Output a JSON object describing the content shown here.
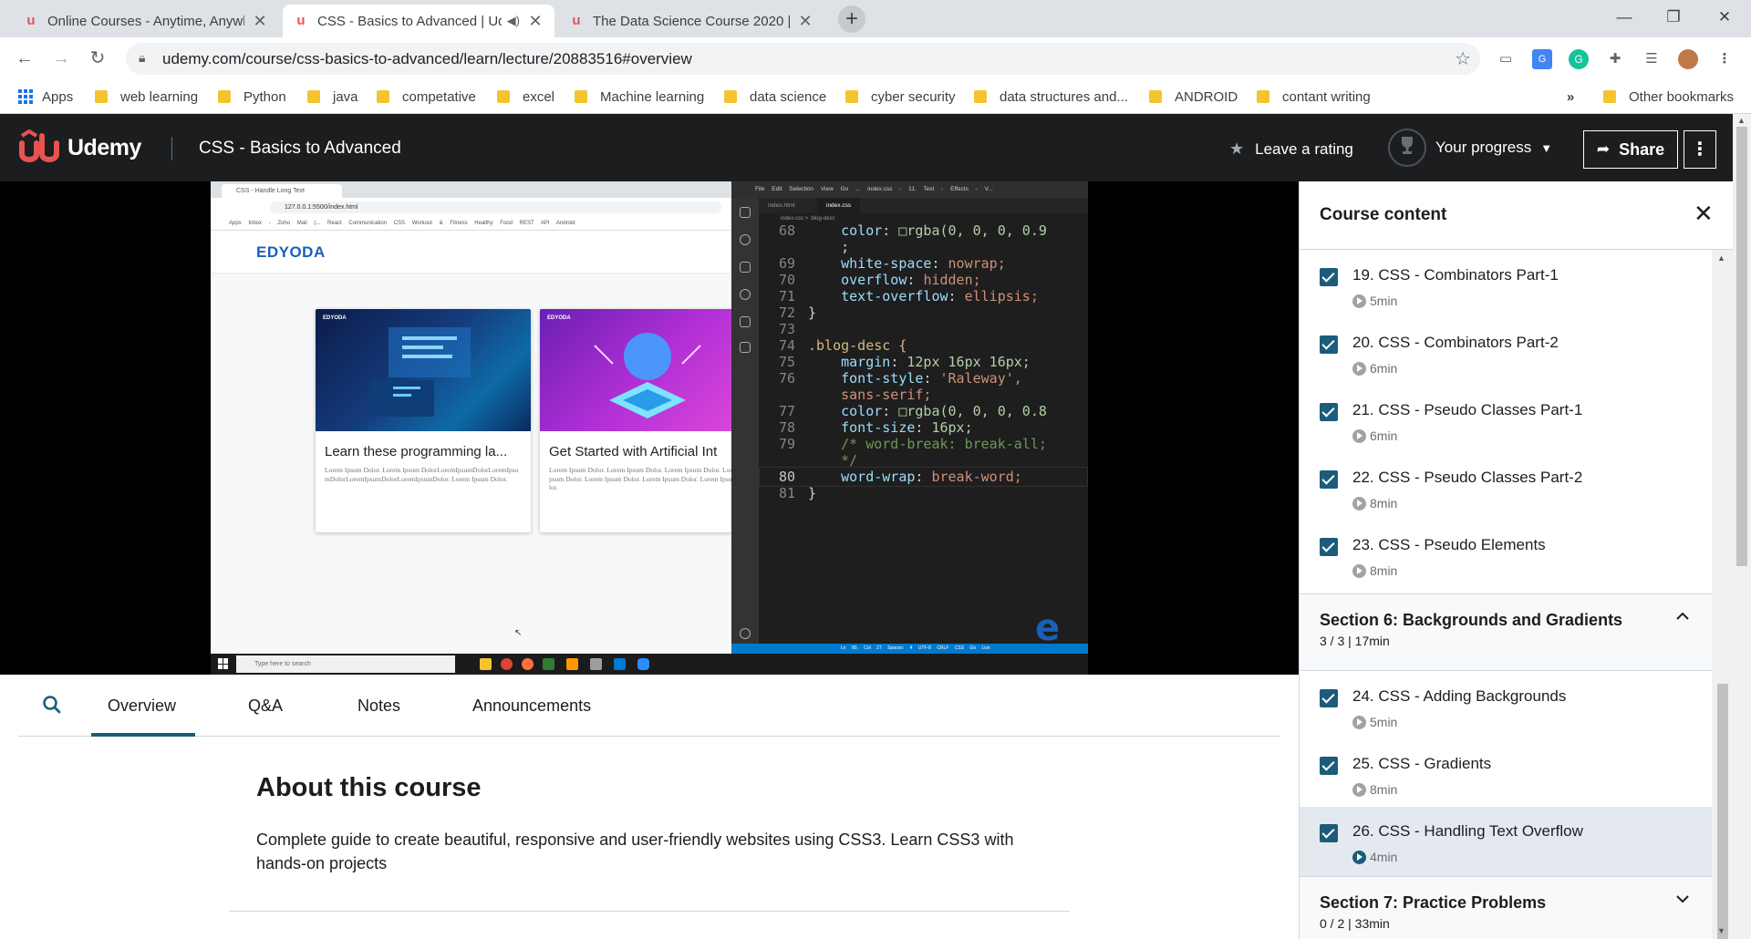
{
  "browser": {
    "tabs": [
      {
        "title": "Online Courses - Anytime, Anywh",
        "active": false
      },
      {
        "title": "CSS - Basics to Advanced | Ud",
        "active": true,
        "audio": true
      },
      {
        "title": "The Data Science Course 2020 | U",
        "active": false
      }
    ],
    "url": "udemy.com/course/css-basics-to-advanced/learn/lecture/20883516#overview",
    "bookmarks": [
      "Apps",
      "web learning",
      "Python",
      "java",
      "competative",
      "excel",
      "Machine learning",
      "data science",
      "cyber security",
      "data structures and...",
      "ANDROID",
      "contant writing"
    ],
    "bookmarks_more": "»",
    "other_bookmarks": "Other bookmarks"
  },
  "header": {
    "brand": "Udemy",
    "course_title": "CSS - Basics to Advanced",
    "leave_rating": "Leave a rating",
    "your_progress": "Your progress",
    "share": "Share"
  },
  "video": {
    "mini_browser": {
      "tab": "CSS - Handle Long Text",
      "url": "127.0.0.1:5500/index.html",
      "bookmarks": "Apps Inbox - Zoho Mail (... React Communication CSS Workout & Fitness Healthy Food REST API Android"
    },
    "site_brand": "EDYODA",
    "cards": [
      {
        "brand": "EDYODA",
        "title": "Learn these programming la...",
        "desc": "Lorem Ipsum Dolor. Lorem Ipsum DolorLoremIpsumDolorLoremIpsumDolorLoremIpsumDolorLoremIpsumDolor. Lorem Ipsum Dolor."
      },
      {
        "brand": "EDYODA",
        "title": "Get Started with Artificial Int",
        "desc": "Lorem Ipsum Dolor. Lorem Ipsum Dolor. Lorem Ipsum Dolor. Lorem Ipsum Dolor. Lorem Ipsum Dolor. Lorem Ipsum Dolor. Lorem Ipsum Dolor."
      }
    ],
    "taskbar_search": "Type here to search",
    "vscode": {
      "title": "File  Edit  Selection  View  Go  ...  index.css - 11. Text - Effects - V...",
      "tabs": [
        "index.html",
        "index.css"
      ],
      "breadcrumb": "index.css > .blog-desc",
      "status": "Ln 80, Col 27  Spaces: 4  UTF-8  CRLF  CSS  Go Live",
      "lines": [
        {
          "n": "68",
          "code": "    color: □rgba(0, 0, 0, 0.9"
        },
        {
          "n": "",
          "code": "    ;"
        },
        {
          "n": "69",
          "code": "    white-space: nowrap;"
        },
        {
          "n": "70",
          "code": "    overflow: hidden;"
        },
        {
          "n": "71",
          "code": "    text-overflow: ellipsis;"
        },
        {
          "n": "72",
          "code": "}"
        },
        {
          "n": "73",
          "code": ""
        },
        {
          "n": "74",
          "code": ".blog-desc {"
        },
        {
          "n": "75",
          "code": "    margin: 12px 16px 16px;"
        },
        {
          "n": "76",
          "code": "    font-style: 'Raleway',"
        },
        {
          "n": "",
          "code": "    sans-serif;"
        },
        {
          "n": "77",
          "code": "    color: □rgba(0, 0, 0, 0.8"
        },
        {
          "n": "78",
          "code": "    font-size: 16px;"
        },
        {
          "n": "79",
          "code": "    /* word-break: break-all;"
        },
        {
          "n": "",
          "code": "    */"
        },
        {
          "n": "80",
          "code": "    word-wrap: break-word;"
        },
        {
          "n": "81",
          "code": "}"
        }
      ]
    }
  },
  "content_tabs": [
    "Overview",
    "Q&A",
    "Notes",
    "Announcements"
  ],
  "about": {
    "heading": "About this course",
    "description": "Complete guide to create beautiful, responsive and user-friendly websites using CSS3. Learn CSS3 with hands-on projects"
  },
  "sidebar": {
    "title": "Course content",
    "lectures_top": [
      {
        "title": "19. CSS - Combinators Part-1",
        "duration": "5min"
      },
      {
        "title": "20. CSS - Combinators Part-2",
        "duration": "6min"
      },
      {
        "title": "21. CSS - Pseudo Classes Part-1",
        "duration": "6min"
      },
      {
        "title": "22. CSS - Pseudo Classes Part-2",
        "duration": "8min"
      },
      {
        "title": "23. CSS - Pseudo Elements",
        "duration": "8min"
      }
    ],
    "section6": {
      "title": "Section 6: Backgrounds and Gradients",
      "summary": "3 / 3 | 17min"
    },
    "lectures_s6": [
      {
        "title": "24. CSS - Adding Backgrounds",
        "duration": "5min"
      },
      {
        "title": "25. CSS - Gradients",
        "duration": "8min"
      },
      {
        "title": "26. CSS - Handling Text Overflow",
        "duration": "4min"
      }
    ],
    "section7": {
      "title": "Section 7: Practice Problems",
      "summary": "0 / 2 | 33min"
    }
  },
  "colors": {
    "udemy_dark": "#1c1d1f",
    "udemy_red": "#ea5252",
    "check": "#1c5c7a",
    "current_row": "#e4e9f0"
  }
}
